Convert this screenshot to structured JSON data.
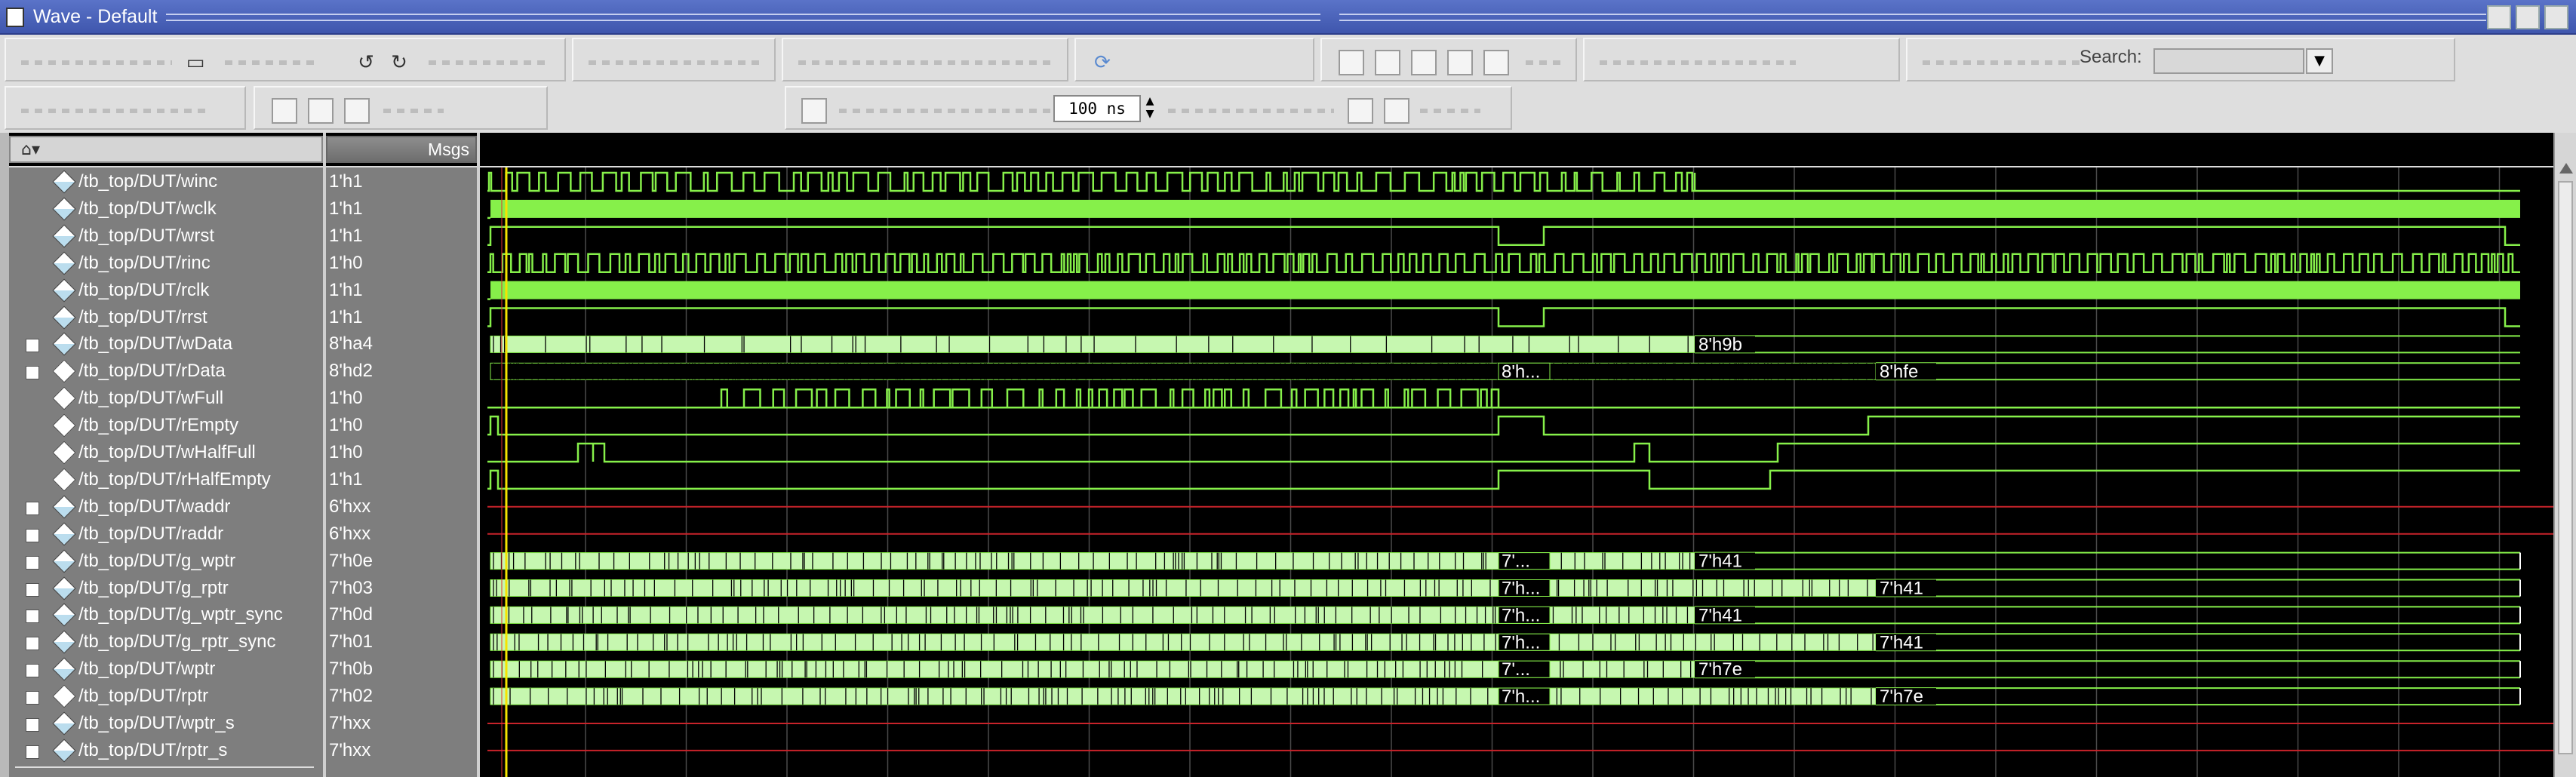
{
  "window": {
    "title": "Wave - Default"
  },
  "toolbar": {
    "search_label": "Search:",
    "search_value": "",
    "time_value": "100 ns"
  },
  "panes": {
    "msgs_header": "Msgs"
  },
  "signals": [
    {
      "name": "/tb_top/DUT/winc",
      "value": "1'h1",
      "type": "bit",
      "icon": "input-port-icon",
      "expandable": false
    },
    {
      "name": "/tb_top/DUT/wclk",
      "value": "1'h1",
      "type": "clock",
      "icon": "input-port-icon",
      "expandable": false
    },
    {
      "name": "/tb_top/DUT/wrst",
      "value": "1'h1",
      "type": "bit",
      "icon": "input-port-icon",
      "expandable": false
    },
    {
      "name": "/tb_top/DUT/rinc",
      "value": "1'h0",
      "type": "bit",
      "icon": "input-port-icon",
      "expandable": false
    },
    {
      "name": "/tb_top/DUT/rclk",
      "value": "1'h1",
      "type": "clock",
      "icon": "input-port-icon",
      "expandable": false
    },
    {
      "name": "/tb_top/DUT/rrst",
      "value": "1'h1",
      "type": "bit",
      "icon": "input-port-icon",
      "expandable": false
    },
    {
      "name": "/tb_top/DUT/wData",
      "value": "8'ha4",
      "type": "bus",
      "icon": "input-port-icon",
      "expandable": true
    },
    {
      "name": "/tb_top/DUT/rData",
      "value": "8'hd2",
      "type": "bus",
      "icon": "output-port-icon",
      "expandable": true
    },
    {
      "name": "/tb_top/DUT/wFull",
      "value": "1'h0",
      "type": "bit",
      "icon": "output-port-icon",
      "expandable": false
    },
    {
      "name": "/tb_top/DUT/rEmpty",
      "value": "1'h0",
      "type": "bit",
      "icon": "output-port-icon",
      "expandable": false
    },
    {
      "name": "/tb_top/DUT/wHalfFull",
      "value": "1'h0",
      "type": "bit",
      "icon": "output-port-icon",
      "expandable": false
    },
    {
      "name": "/tb_top/DUT/rHalfEmpty",
      "value": "1'h1",
      "type": "bit",
      "icon": "output-port-icon",
      "expandable": false
    },
    {
      "name": "/tb_top/DUT/waddr",
      "value": "6'hxx",
      "type": "bus-x",
      "icon": "internal-signal-icon",
      "expandable": true
    },
    {
      "name": "/tb_top/DUT/raddr",
      "value": "6'hxx",
      "type": "bus-x",
      "icon": "internal-signal-icon",
      "expandable": true
    },
    {
      "name": "/tb_top/DUT/g_wptr",
      "value": "7'h0e",
      "type": "bus",
      "icon": "internal-signal-icon",
      "expandable": true
    },
    {
      "name": "/tb_top/DUT/g_rptr",
      "value": "7'h03",
      "type": "bus",
      "icon": "internal-signal-icon",
      "expandable": true
    },
    {
      "name": "/tb_top/DUT/g_wptr_sync",
      "value": "7'h0d",
      "type": "bus",
      "icon": "internal-signal-icon",
      "expandable": true
    },
    {
      "name": "/tb_top/DUT/g_rptr_sync",
      "value": "7'h01",
      "type": "bus",
      "icon": "internal-signal-icon",
      "expandable": true
    },
    {
      "name": "/tb_top/DUT/wptr",
      "value": "7'h0b",
      "type": "bus",
      "icon": "internal-signal-icon",
      "expandable": true
    },
    {
      "name": "/tb_top/DUT/rptr",
      "value": "7'h02",
      "type": "bus",
      "icon": "output-port-icon",
      "expandable": true
    },
    {
      "name": "/tb_top/DUT/wptr_s",
      "value": "7'hxx",
      "type": "bus-x",
      "icon": "internal-signal-icon",
      "expandable": true
    },
    {
      "name": "/tb_top/DUT/rptr_s",
      "value": "7'hxx",
      "type": "bus-x",
      "icon": "internal-signal-icon",
      "expandable": true
    }
  ],
  "bus_labels": [
    {
      "row": 6,
      "text": "8'h9b"
    },
    {
      "row": 7,
      "text": "8'h..."
    },
    {
      "row": 7,
      "text": "8'hfe"
    },
    {
      "row": 14,
      "text": "7'..."
    },
    {
      "row": 14,
      "text": "7'h41"
    },
    {
      "row": 15,
      "text": "7'h..."
    },
    {
      "row": 15,
      "text": "7'h41"
    },
    {
      "row": 16,
      "text": "7'h..."
    },
    {
      "row": 16,
      "text": "7'h41"
    },
    {
      "row": 17,
      "text": "7'h..."
    },
    {
      "row": 17,
      "text": "7'h41"
    },
    {
      "row": 18,
      "text": "7'..."
    },
    {
      "row": 18,
      "text": "7'h7e"
    },
    {
      "row": 19,
      "text": "7'h..."
    },
    {
      "row": 19,
      "text": "7'h7e"
    }
  ],
  "colors": {
    "wave": "#86f04a",
    "bus": "#c6f7b0",
    "undefined": "#c8232a",
    "cursor": "#f5e400",
    "grid": "#4a4a4a"
  }
}
